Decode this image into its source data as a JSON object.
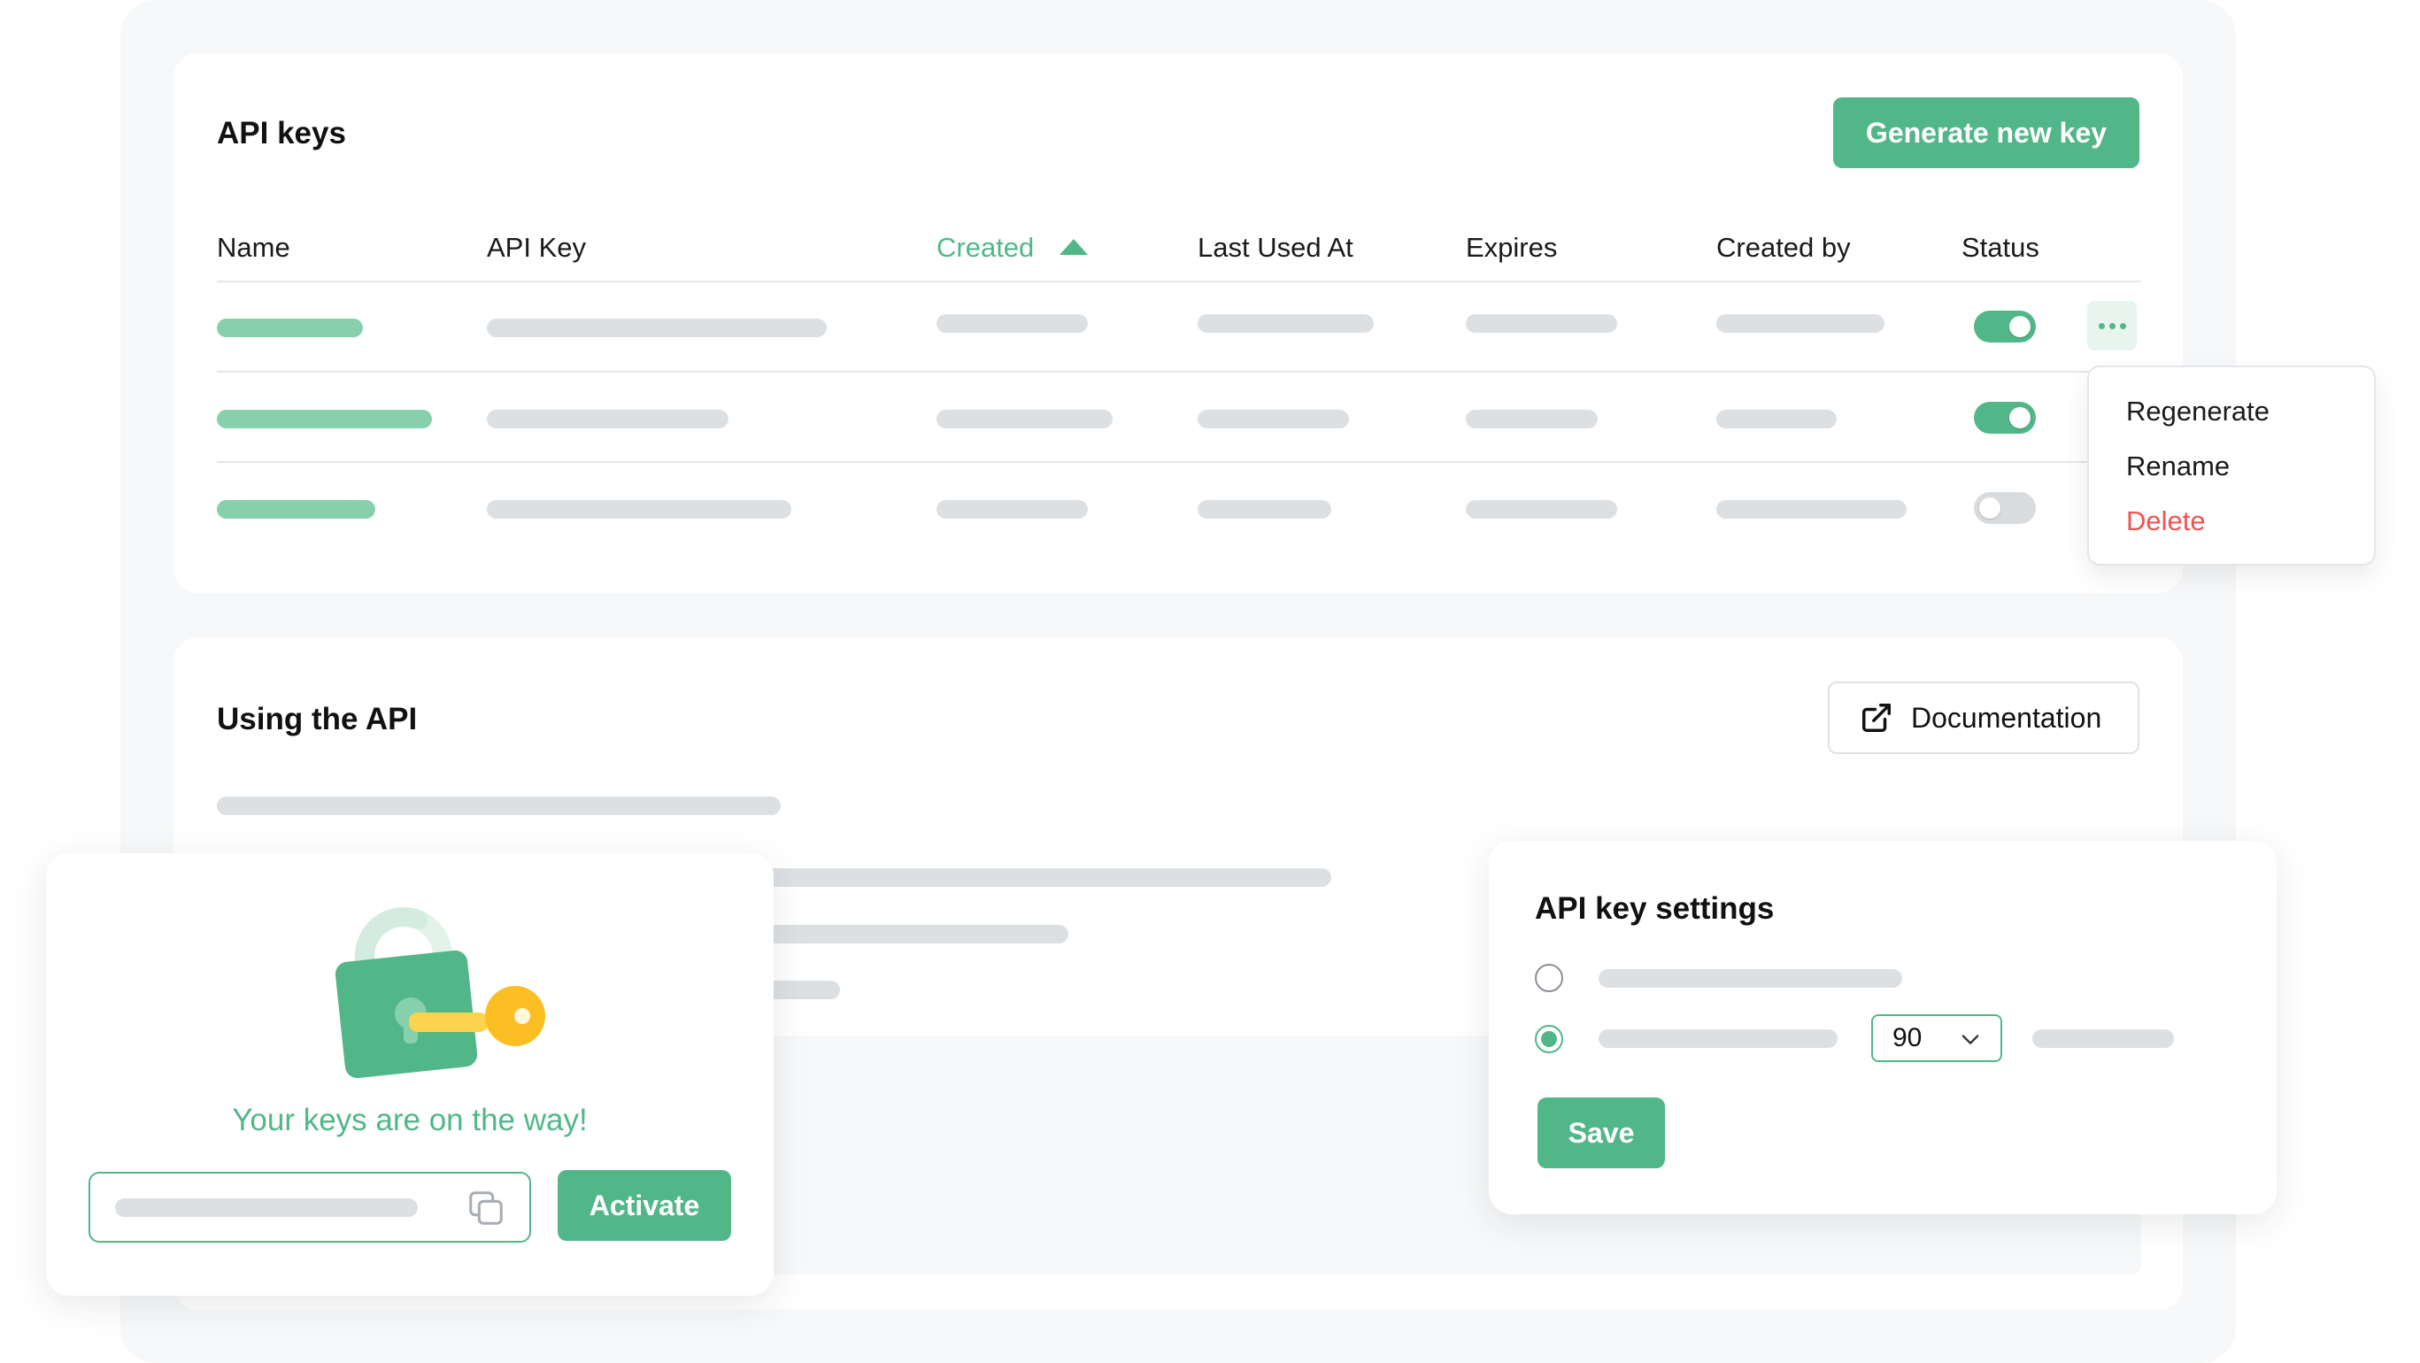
{
  "api_keys": {
    "title": "API keys",
    "generate_label": "Generate new key",
    "columns": [
      "Name",
      "API Key",
      "Created",
      "Last Used At",
      "Expires",
      "Created by",
      "Status"
    ],
    "sorted_column": "Created",
    "sort_direction": "ascending",
    "rows": [
      {
        "status_enabled": true
      },
      {
        "status_enabled": true
      },
      {
        "status_enabled": false
      }
    ],
    "row_menu": {
      "items": [
        "Regenerate",
        "Rename",
        "Delete"
      ],
      "danger_item": "Delete"
    }
  },
  "using_api": {
    "title": "Using the API",
    "documentation_label": "Documentation"
  },
  "activate_card": {
    "tagline": "Your keys are on the way!",
    "activate_label": "Activate"
  },
  "settings": {
    "title": "API key settings",
    "expiry_value": "90",
    "selected_option": 2,
    "save_label": "Save"
  },
  "colors": {
    "accent": "#52b788",
    "danger": "#f0534d",
    "placeholder_bar": "#dde0e3",
    "placeholder_bar_accent": "#86d0ac",
    "key_gold": "#fcd34d"
  },
  "icons": [
    "more-horizontal-icon",
    "external-link-icon",
    "copy-icon",
    "chevron-down-icon",
    "lock-key-illustration"
  ]
}
